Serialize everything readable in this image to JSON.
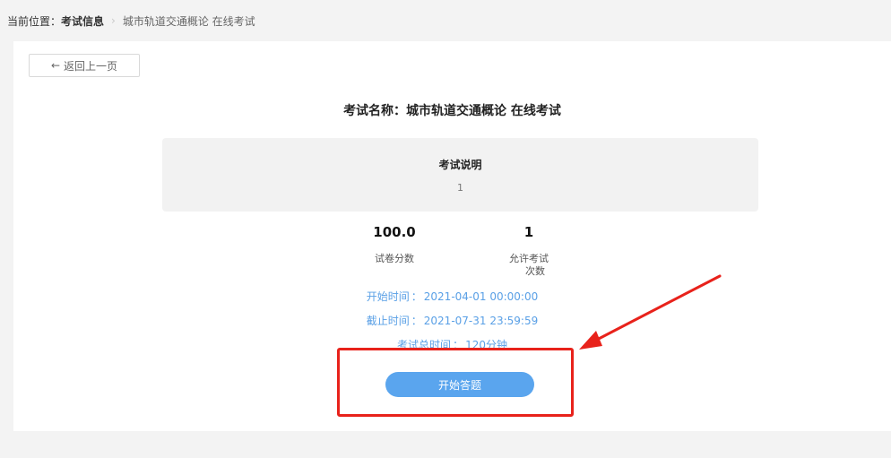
{
  "breadcrumb": {
    "label": "当前位置：",
    "current": "考试信息",
    "page": "城市轨道交通概论 在线考试"
  },
  "back_button": {
    "arrow": "←",
    "label": "返回上一页"
  },
  "exam": {
    "title_label": "考试名称：",
    "title_value": "城市轨道交通概论 在线考试"
  },
  "description": {
    "title": "考试说明",
    "content": "1"
  },
  "stats": {
    "score_value": "100.0",
    "score_label": "试卷分数",
    "attempts_value": "1",
    "attempts_label_line1": "允许考试",
    "attempts_label_line2": "次数"
  },
  "times": {
    "start_label": "开始时间",
    "start_value": "2021-04-01 00:00:00",
    "end_label": "截止时间",
    "end_value": "2021-07-31 23:59:59",
    "duration_label": "考试总时间",
    "duration_value": "120分钟",
    "separator": "："
  },
  "start_button": {
    "label": "开始答题"
  },
  "colors": {
    "accent": "#5aa5ee",
    "link_text": "#5aa0e6",
    "annotation": "#e8221b"
  }
}
